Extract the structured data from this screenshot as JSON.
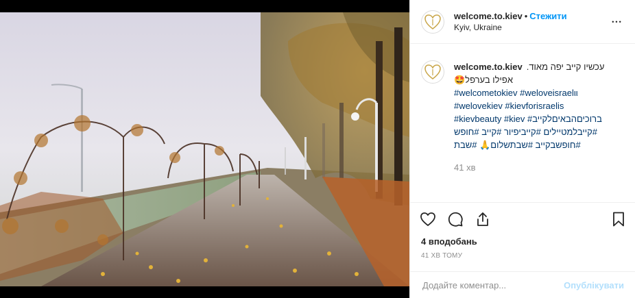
{
  "post": {
    "username": "welcome.to.kiev",
    "separator": "•",
    "follow_label": "Стежити",
    "location": "Kyiv, Ukraine",
    "more_label": "•••",
    "photo_alt": "Foggy autumn park alley with street lamps and fallen yellow leaves"
  },
  "caption": {
    "username": "welcome.to.kiev",
    "line1": "עכשיו קייב יפה מאוד.",
    "line2": "אפילו בערפל🤩",
    "hashtags_line1": "#welcometokiev #weloveisraelιι",
    "hashtags_line2": "#welovekiev #kievforisraelis",
    "hashtags_line3": "#kievbeauty #kiev #ברוכיםהבאיםלקייב",
    "hashtags_line4": "#קייבלמטיילים #קייביפיור #קייב #חופש",
    "hashtags_line5": "#חופשבקייב #שבתשלום🙏 #שבת",
    "time": "41 хв"
  },
  "actions": {
    "likes": "4 вподобань",
    "time_ago": "41 хв тому"
  },
  "comment_box": {
    "placeholder": "Додайте коментар...",
    "post_label": "Опублікувати"
  },
  "colors": {
    "link_blue": "#0095f6",
    "hashtag": "#00376b",
    "muted": "#8e8e8e",
    "post_disabled": "#b2dffc"
  },
  "icons": {
    "like": "heart-icon",
    "comment": "comment-bubble-icon",
    "share": "share-icon",
    "save": "bookmark-icon",
    "more": "more-dots-icon"
  }
}
